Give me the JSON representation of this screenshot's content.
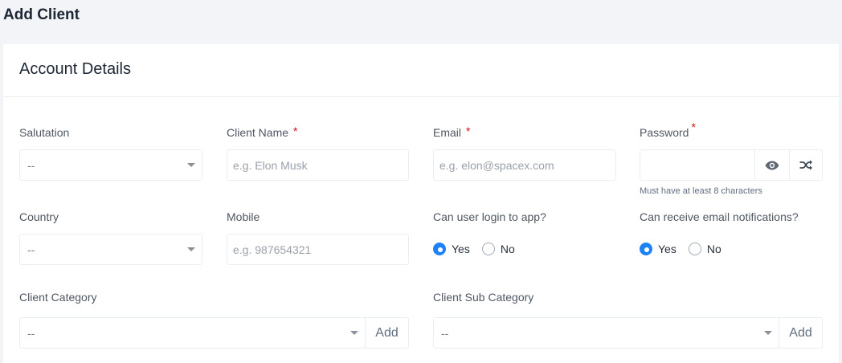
{
  "page": {
    "title": "Add Client"
  },
  "card": {
    "title": "Account Details"
  },
  "salutation": {
    "label": "Salutation",
    "value": "--"
  },
  "client_name": {
    "label": "Client Name",
    "required": "*",
    "placeholder": "e.g. Elon Musk"
  },
  "email": {
    "label": "Email",
    "required": "*",
    "placeholder": "e.g. elon@spacex.com"
  },
  "password": {
    "label": "Password",
    "required": "*",
    "hint": "Must have at least 8 characters",
    "show_icon": "eye-icon",
    "generate_icon": "shuffle-icon"
  },
  "country": {
    "label": "Country",
    "value": "--"
  },
  "mobile": {
    "label": "Mobile",
    "placeholder": "e.g. 987654321"
  },
  "login": {
    "label": "Can user login to app?",
    "yes": "Yes",
    "no": "No",
    "selected": "Yes"
  },
  "notifications": {
    "label": "Can receive email notifications?",
    "yes": "Yes",
    "no": "No",
    "selected": "Yes"
  },
  "client_category": {
    "label": "Client Category",
    "value": "--",
    "add_label": "Add"
  },
  "client_sub_category": {
    "label": "Client Sub Category",
    "value": "--",
    "add_label": "Add"
  },
  "colors": {
    "accent": "#1d82f5",
    "required": "#d21010"
  }
}
